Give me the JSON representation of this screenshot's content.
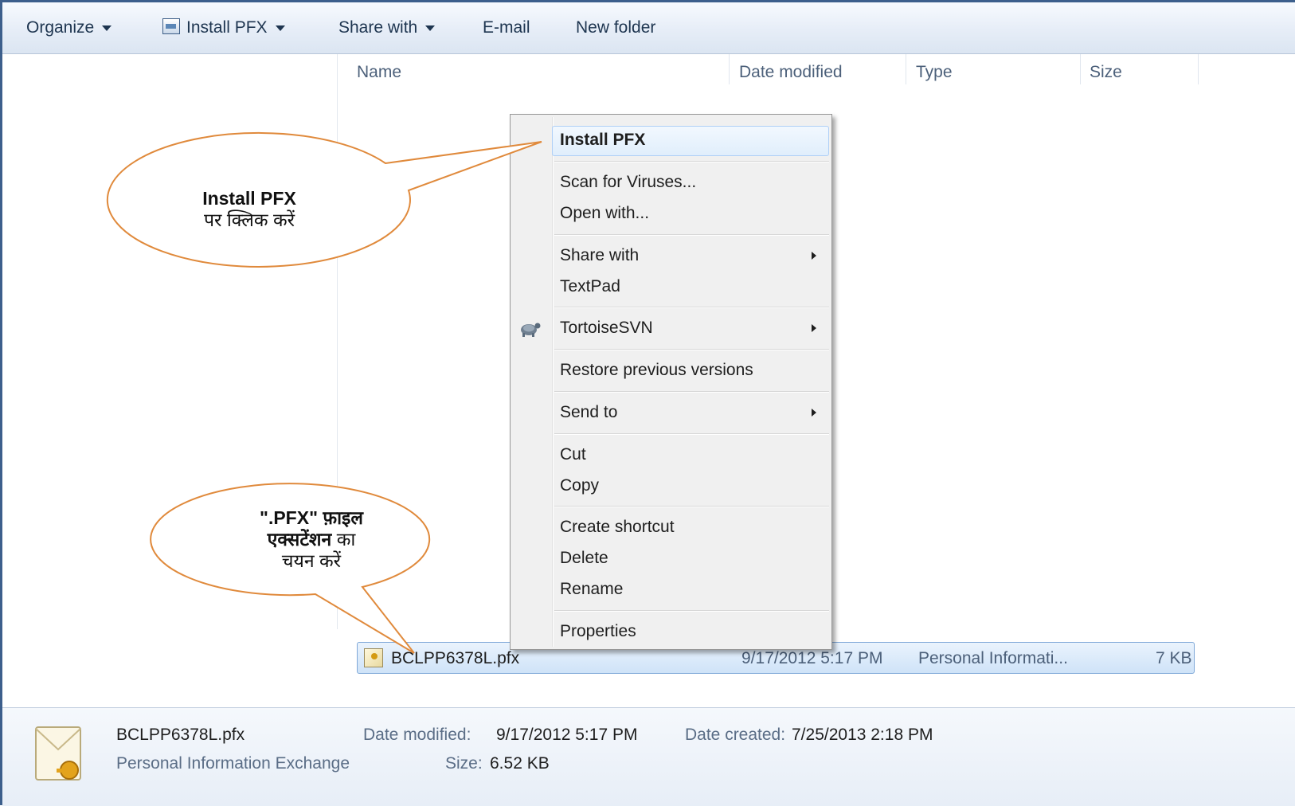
{
  "toolbar": {
    "organize": "Organize",
    "install_pfx": "Install PFX",
    "share_with": "Share with",
    "email": "E-mail",
    "new_folder": "New folder"
  },
  "columns": {
    "name": "Name",
    "date_modified": "Date modified",
    "type": "Type",
    "size": "Size"
  },
  "file": {
    "name": "BCLPP6378L.pfx",
    "date": "9/17/2012 5:17 PM",
    "type": "Personal Informati...",
    "size": "7 KB"
  },
  "context_menu": {
    "install_pfx": "Install PFX",
    "scan": "Scan for Viruses...",
    "open_with": "Open with...",
    "share_with": "Share with",
    "textpad": "TextPad",
    "tortoisesvn": "TortoiseSVN",
    "restore": "Restore previous versions",
    "send_to": "Send to",
    "cut": "Cut",
    "copy": "Copy",
    "create_shortcut": "Create shortcut",
    "delete": "Delete",
    "rename": "Rename",
    "properties": "Properties"
  },
  "callouts": {
    "install_title": "Install PFX",
    "install_sub": "पर क्लिक करें",
    "select_bold": "\".PFX\" फ़ाइल एक्सटेंशन",
    "select_rest": "का",
    "select_line3": "चयन करें"
  },
  "details": {
    "filename": "BCLPP6378L.pfx",
    "filetype": "Personal Information Exchange",
    "date_modified_label": "Date modified:",
    "date_modified": "9/17/2012 5:17 PM",
    "date_created_label": "Date created:",
    "date_created": "7/25/2013 2:18 PM",
    "size_label": "Size:",
    "size": "6.52 KB"
  },
  "colors": {
    "callout_border": "#e08a3c",
    "selection": "#cfe3f8",
    "frame": "#3d5f8c"
  }
}
